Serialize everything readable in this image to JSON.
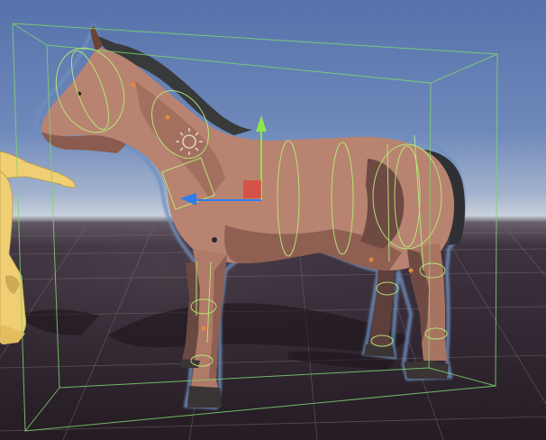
{
  "scene_view": {
    "selected_object": "horse",
    "skybox": {
      "top": "#5b79b2",
      "horizon": "#b6c3d4",
      "ground": "#2b1f28"
    },
    "colors": {
      "horse_body": "#b88370",
      "horse_shadow_side": "#6e4a43",
      "horse_mane": "#38393b",
      "hooves": "#3b3435",
      "selection_outline": "#6e8fbd",
      "bounds_wire": "#7dd36f",
      "collider_wire": "#b7f07a",
      "gizmo_y_axis": "#8ee64c",
      "gizmo_x_axis": "#2f7df0",
      "gizmo_center": "#e0413a",
      "mannequin": "#f0cf74"
    },
    "gizmos": {
      "move_tool": "position-handle",
      "axes": [
        "y-axis",
        "x-axis"
      ],
      "light_icon": "sun-icon"
    }
  }
}
